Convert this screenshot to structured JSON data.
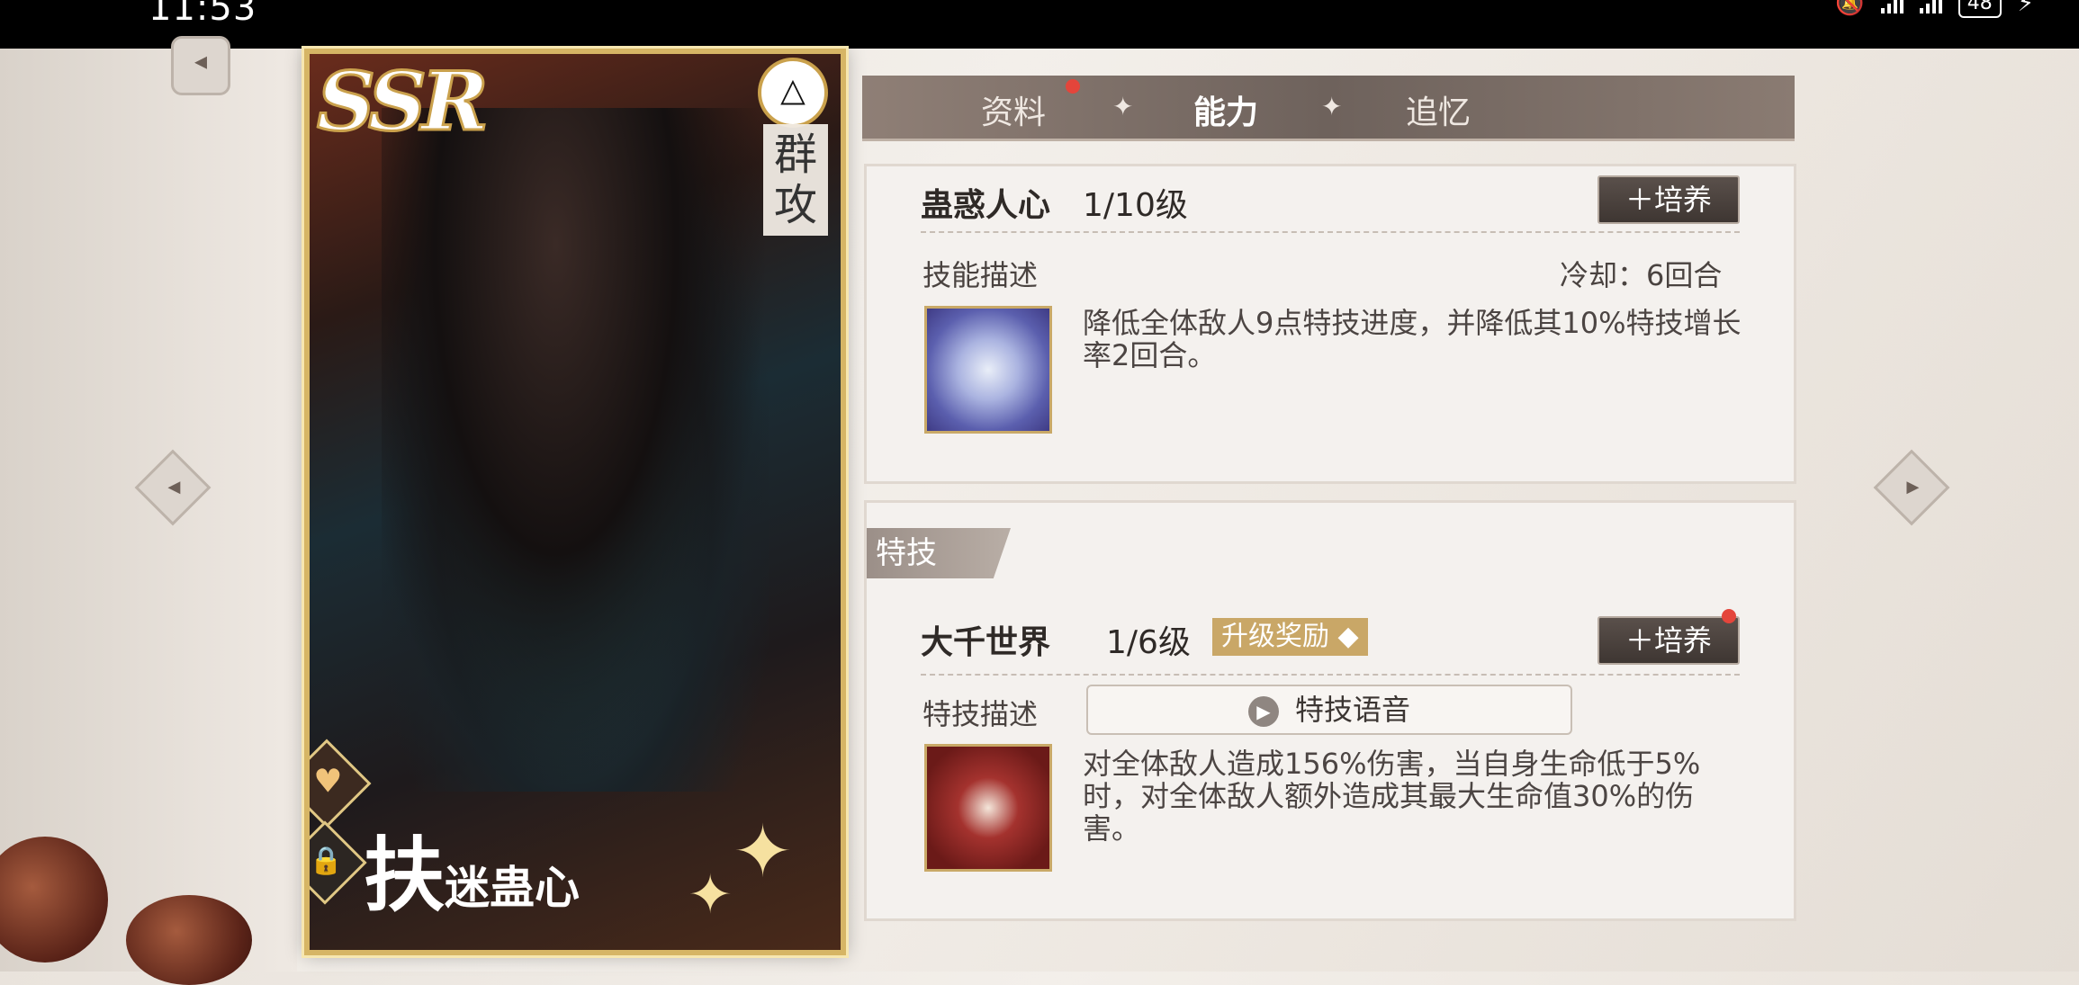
{
  "status": {
    "time": "11:53",
    "battery": "48"
  },
  "card": {
    "rarity": "SSR",
    "type_icon": "triangle-symbol",
    "type_label": "群攻",
    "name_big": "扶",
    "name_small": "迷蛊心"
  },
  "tabs": [
    {
      "label": "资料"
    },
    {
      "label": "能力"
    },
    {
      "label": "追忆"
    }
  ],
  "skill": {
    "name": "蛊惑人心",
    "level": "1/10级",
    "grow_button": "培养",
    "desc_label": "技能描述",
    "cooldown": "冷却：6回合",
    "description": "降低全体敌人9点特技进度，并降低其10%特技增长率2回合。"
  },
  "special": {
    "tag": "特技",
    "name": "大千世界",
    "level": "1/6级",
    "upgrade_reward": "升级奖励",
    "grow_button": "培养",
    "desc_label": "特技描述",
    "voice_button": "特技语音",
    "description": "对全体敌人造成156%伤害，当自身生命低于5%时，对全体敌人额外造成其最大生命值30%的伤害。"
  },
  "colors": {
    "accent_gold": "#caa14c",
    "notify_red": "#e4453b"
  }
}
